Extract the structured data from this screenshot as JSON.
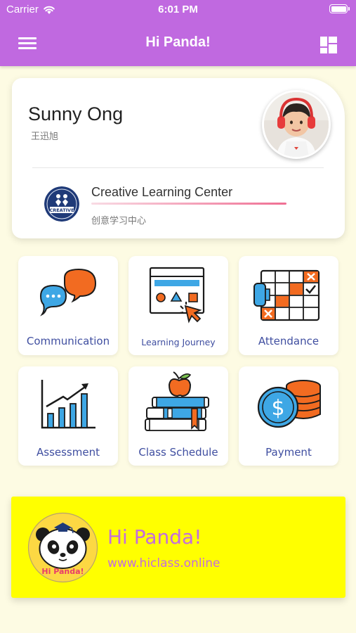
{
  "status_bar": {
    "carrier": "Carrier",
    "time": "6:01 PM",
    "icons": [
      "wifi-icon",
      "battery-icon"
    ]
  },
  "nav": {
    "title": "Hi Panda!",
    "left_icon": "menu-icon",
    "right_icon": "dashboard-grid-icon"
  },
  "profile": {
    "name": "Sunny Ong",
    "name_cn": "王迅旭",
    "center_name": "Creative Learning Center",
    "center_name_cn": "创意学习中心",
    "center_logo_text": "CREATIVE"
  },
  "tiles": [
    {
      "label": "Communication",
      "icon": "chat-bubbles-icon"
    },
    {
      "label": "Learning Journey",
      "icon": "browser-cursor-icon"
    },
    {
      "label": "Attendance",
      "icon": "calendar-check-icon"
    },
    {
      "label": "Assessment",
      "icon": "bar-chart-icon"
    },
    {
      "label": "Class Schedule",
      "icon": "books-apple-icon"
    },
    {
      "label": "Payment",
      "icon": "dollar-coins-icon"
    }
  ],
  "banner": {
    "title": "Hi Panda!",
    "url": "www.hiclass.online",
    "logo_text": "Hi Panda!"
  },
  "colors": {
    "header": "#c069e0",
    "background": "#fdfbe3",
    "tile_label": "#3f4ea0",
    "banner_bg": "#ffff00",
    "banner_text": "#c46dde",
    "accent_bar": "#ef6f93"
  }
}
